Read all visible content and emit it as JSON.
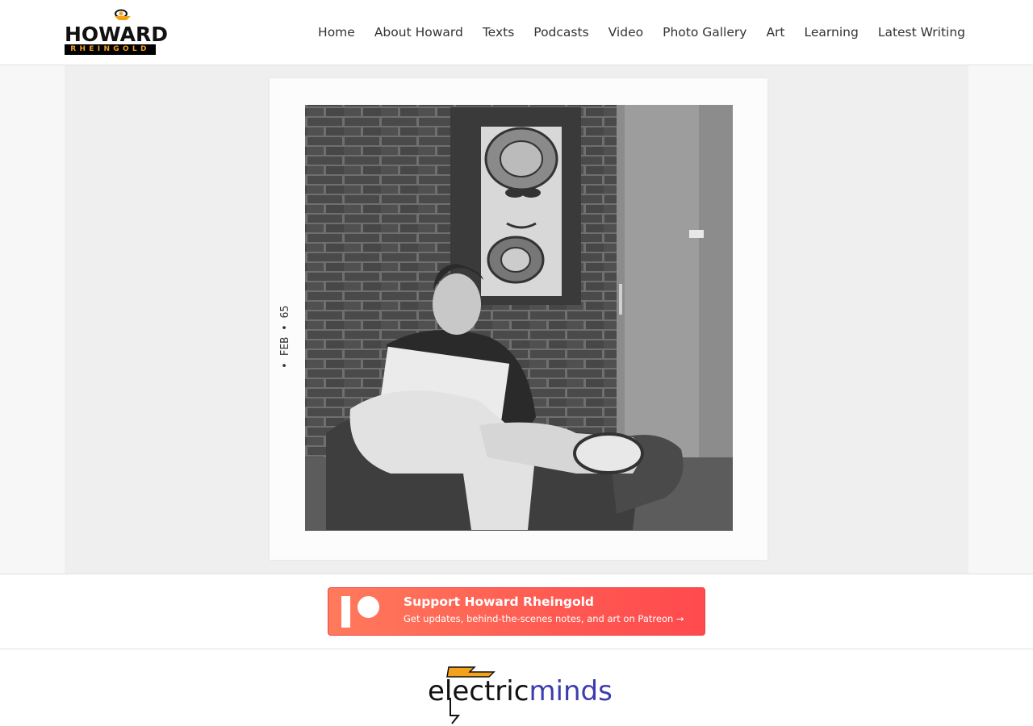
{
  "brand": {
    "logo_word": "HOWARD",
    "logo_sub": "RHEINGOLD",
    "accent": "#f2a31b"
  },
  "nav": [
    {
      "label": "Home"
    },
    {
      "label": "About Howard"
    },
    {
      "label": "Texts"
    },
    {
      "label": "Podcasts"
    },
    {
      "label": "Video"
    },
    {
      "label": "Photo Gallery"
    },
    {
      "label": "Art"
    },
    {
      "label": "Learning"
    },
    {
      "label": "Latest Writing"
    }
  ],
  "photo": {
    "margin_stamp": "• FEB • 65",
    "subject": "black-and-white photo of young man reading in chair beneath a psychedelic wall hanging"
  },
  "patreon": {
    "title": "Support Howard Rheingold",
    "subtitle": "Get updates, behind-the-scenes notes, and art on Patreon →",
    "colors": [
      "#ff7a5c",
      "#ff4a4e"
    ]
  },
  "footer_logo": {
    "part1": "electric",
    "part2": "minds",
    "colors": {
      "part1": "#111111",
      "part2": "#3d3db0",
      "bolt": "#f2a31b"
    }
  }
}
